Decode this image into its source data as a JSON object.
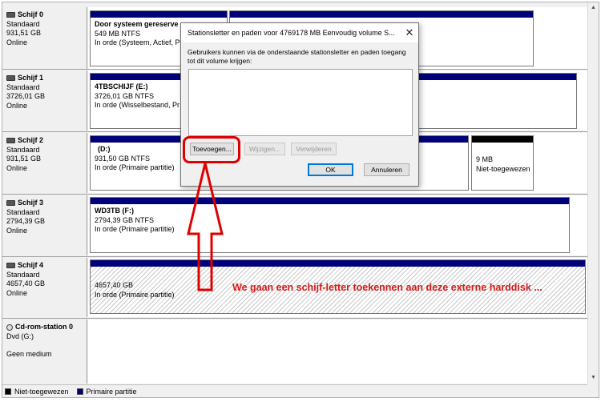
{
  "disks": [
    {
      "name": "Schijf 0",
      "type": "Standaard",
      "size": "931,51 GB",
      "status": "Online"
    },
    {
      "name": "Schijf 1",
      "type": "Standaard",
      "size": "3726,01 GB",
      "status": "Online"
    },
    {
      "name": "Schijf 2",
      "type": "Standaard",
      "size": "931,51 GB",
      "status": "Online"
    },
    {
      "name": "Schijf 3",
      "type": "Standaard",
      "size": "2794,39 GB",
      "status": "Online"
    },
    {
      "name": "Schijf 4",
      "type": "Standaard",
      "size": "4657,40 GB",
      "status": "Online"
    },
    {
      "name": "Cd-rom-station 0",
      "type": "Dvd (G:)",
      "status": "Geen medium"
    }
  ],
  "partitions": {
    "d0p1": {
      "title": "Door systeem gereserve",
      "size": "549 MB NTFS",
      "status": "In orde (Systeem, Actief, P"
    },
    "d1p1": {
      "title": "4TBSCHIJF  (E:)",
      "size": "3726,01 GB NTFS",
      "status": "In orde (Wisselbestand, Pr"
    },
    "d2p1": {
      "title": "(D:)",
      "size": "931,50 GB NTFS",
      "status": "In orde (Primaire partitie)"
    },
    "d2p2": {
      "size": "9 MB",
      "status": "Niet-toegewezen"
    },
    "d3p1": {
      "title": "WD3TB  (F:)",
      "size": "2794,39 GB NTFS",
      "status": "In orde (Primaire partitie)"
    },
    "d4p1": {
      "size": "4657,40 GB",
      "status": "In orde (Primaire partitie)"
    }
  },
  "legend": {
    "unallocated": "Niet-toegewezen",
    "primary": "Primaire partitie"
  },
  "dialog": {
    "title": "Stationsletter en paden voor 4769178 MB  Eenvoudig volume S...",
    "description": "Gebruikers kunnen via de onderstaande stationsletter en paden toegang tot dit volume krijgen:",
    "add": "Toevoegen...",
    "change": "Wijzigen...",
    "remove": "Verwijderen",
    "ok": "OK",
    "cancel": "Annuleren"
  },
  "annotation": "We gaan een schijf-letter toekennen aan deze externe harddisk ...",
  "colors": {
    "primary": "#00007a",
    "unallocated": "#000000",
    "annotation": "#d61a1a"
  }
}
